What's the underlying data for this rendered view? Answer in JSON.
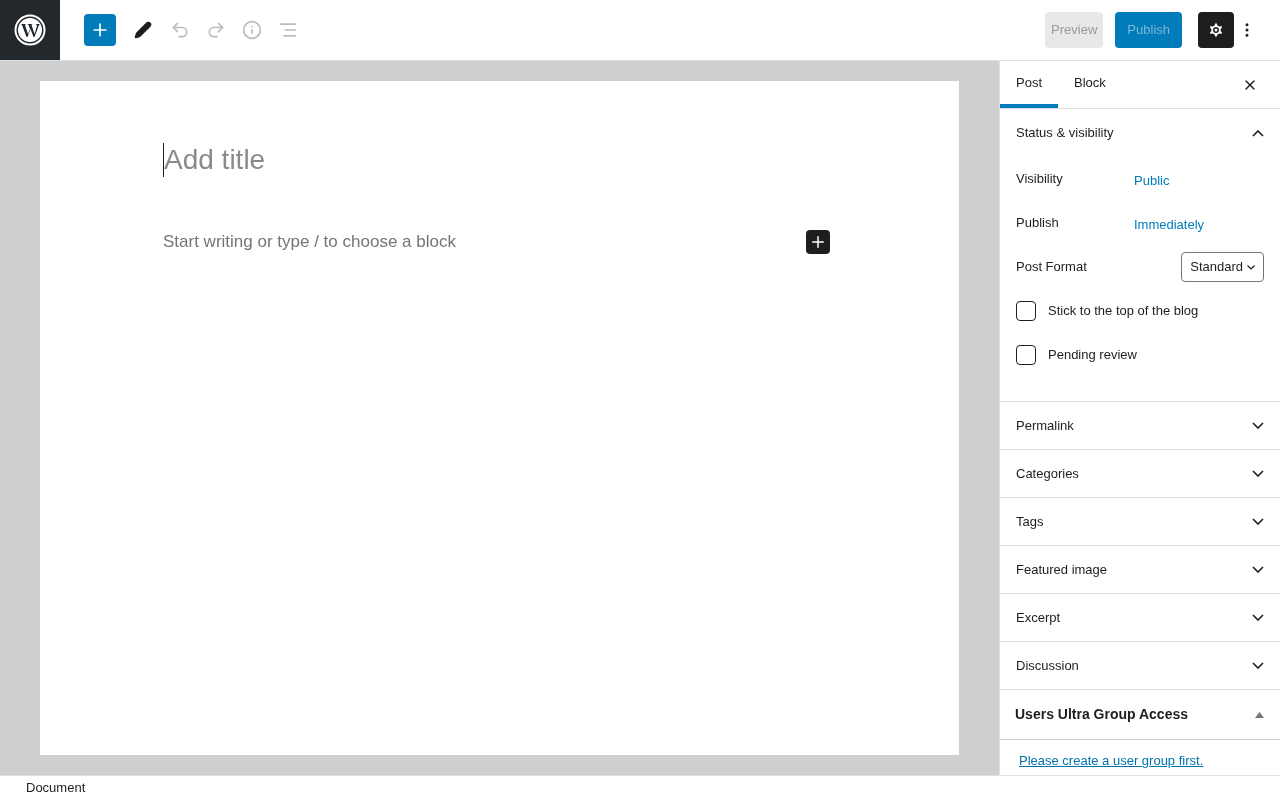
{
  "toolbar": {
    "preview": "Preview",
    "publish": "Publish",
    "settings_active": true
  },
  "editor": {
    "title_placeholder": "Add title",
    "body_placeholder": "Start writing or type / to choose a block"
  },
  "sidebar": {
    "tabs": [
      {
        "label": "Post",
        "selected": true
      },
      {
        "label": "Block",
        "selected": false
      }
    ],
    "status_panel": {
      "title": "Status & visibility",
      "expanded": true,
      "rows": [
        {
          "label": "Visibility",
          "value": "Public"
        },
        {
          "label": "Publish",
          "value": "Immediately"
        }
      ],
      "post_format": {
        "label": "Post Format",
        "value": "Standard"
      },
      "checkboxes": [
        {
          "label": "Stick to the top of the blog",
          "checked": false
        },
        {
          "label": "Pending review",
          "checked": false
        }
      ]
    },
    "panels": [
      {
        "title": "Permalink",
        "expanded": false
      },
      {
        "title": "Categories",
        "expanded": false
      },
      {
        "title": "Tags",
        "expanded": false
      },
      {
        "title": "Featured image",
        "expanded": false
      },
      {
        "title": "Excerpt",
        "expanded": false
      },
      {
        "title": "Discussion",
        "expanded": false
      }
    ],
    "metabox": {
      "title": "Users Ultra Group Access",
      "expanded": true,
      "link": "Please create a user group first."
    }
  },
  "status_bar": "Document"
}
